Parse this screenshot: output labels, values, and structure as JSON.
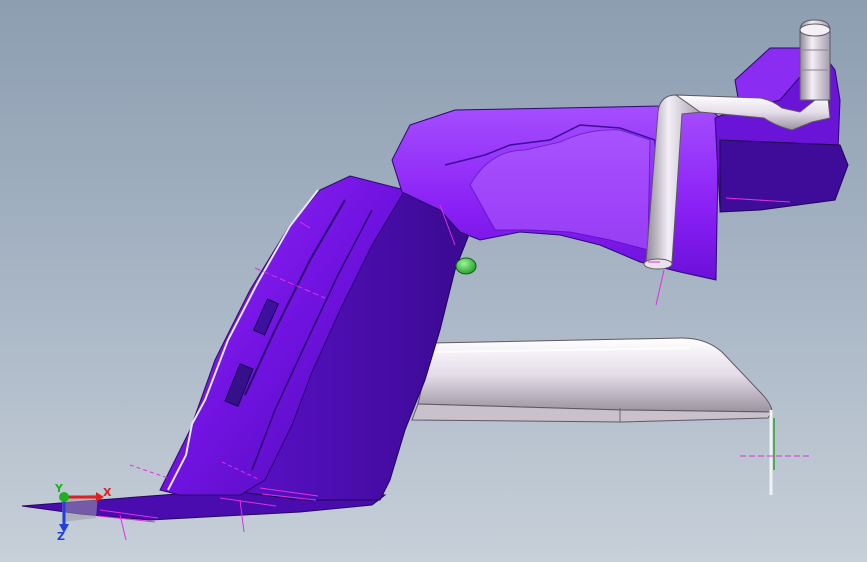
{
  "viewport": {
    "background_top": "#8d9eb1",
    "background_bottom": "#c7d0d9"
  },
  "model": {
    "body_color": "#7a14e8",
    "body_dark": "#3b0c8f",
    "body_light": "#a440ff",
    "pipe_color": "#e8e2ec",
    "pipe_outline": "#6d6673",
    "marker_color": "#e030e0",
    "sphere_color": "#3bd13b"
  },
  "triad": {
    "x_label": "X",
    "y_label": "Y",
    "z_label": "Z",
    "x_color": "#e02020",
    "y_color": "#20b020",
    "z_color": "#2040e0"
  }
}
